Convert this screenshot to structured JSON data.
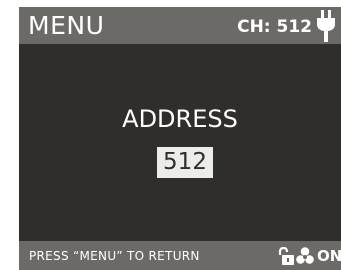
{
  "header": {
    "title": "MENU",
    "channel": "CH: 512",
    "power_icon": "plug-icon"
  },
  "main": {
    "label": "ADDRESS",
    "value": "512"
  },
  "footer": {
    "hint": "PRESS “MENU” TO RETURN",
    "lock_icon": "unlock-icon",
    "fan_icon": "fan-icon",
    "fan_state": "ON"
  },
  "colors": {
    "screen_background": "#302e2b",
    "bar_background": "#6c6a66",
    "text": "#ffffff",
    "value_box": "#ececea"
  }
}
